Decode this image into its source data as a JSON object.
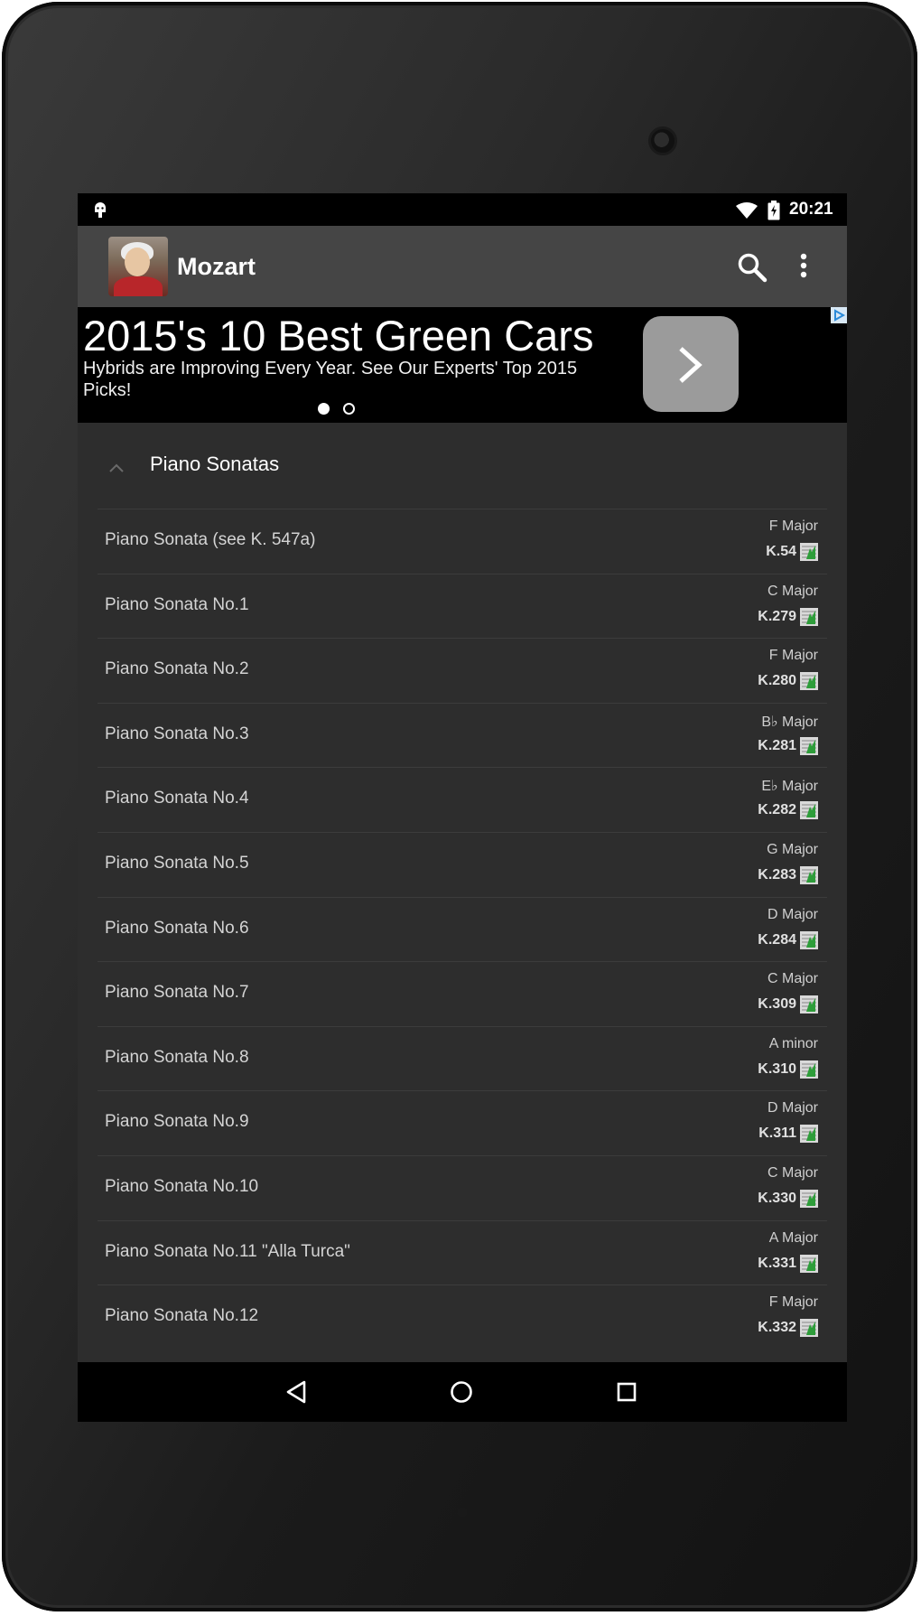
{
  "status_bar": {
    "time": "20:21",
    "icons": [
      "android-debug-icon",
      "wifi-icon",
      "battery-icon"
    ]
  },
  "app_bar": {
    "title": "Mozart",
    "icons": [
      "mozart-portrait",
      "search-icon",
      "overflow-menu-icon"
    ]
  },
  "ad": {
    "headline": "2015's 10 Best Green Cars",
    "body": "Hybrids are Improving Every Year. See Our Experts' Top 2015 Picks!",
    "page_indicator": {
      "total": 2,
      "active": 1
    }
  },
  "section": {
    "title": "Piano Sonatas",
    "expanded": true
  },
  "list": {
    "items": [
      {
        "title": "Piano Sonata (see K. 547a)",
        "key": "F Major",
        "k": "K.54"
      },
      {
        "title": "Piano Sonata No.1",
        "key": "C Major",
        "k": "K.279"
      },
      {
        "title": "Piano Sonata No.2",
        "key": "F Major",
        "k": "K.280"
      },
      {
        "title": "Piano Sonata No.3",
        "key": "B♭ Major",
        "k": "K.281"
      },
      {
        "title": "Piano Sonata No.4",
        "key": "E♭ Major",
        "k": "K.282"
      },
      {
        "title": "Piano Sonata No.5",
        "key": "G Major",
        "k": "K.283"
      },
      {
        "title": "Piano Sonata No.6",
        "key": "D Major",
        "k": "K.284"
      },
      {
        "title": "Piano Sonata No.7",
        "key": "C Major",
        "k": "K.309"
      },
      {
        "title": "Piano Sonata No.8",
        "key": "A minor",
        "k": "K.310"
      },
      {
        "title": "Piano Sonata No.9",
        "key": "D Major",
        "k": "K.311"
      },
      {
        "title": "Piano Sonata No.10",
        "key": "C Major",
        "k": "K.330"
      },
      {
        "title": "Piano Sonata No.11 \"Alla Turca\"",
        "key": "A Major",
        "k": "K.331"
      },
      {
        "title": "Piano Sonata No.12",
        "key": "F Major",
        "k": "K.332"
      }
    ]
  },
  "nav_bar": {
    "icons": [
      "back-icon",
      "home-icon",
      "recents-icon"
    ]
  }
}
